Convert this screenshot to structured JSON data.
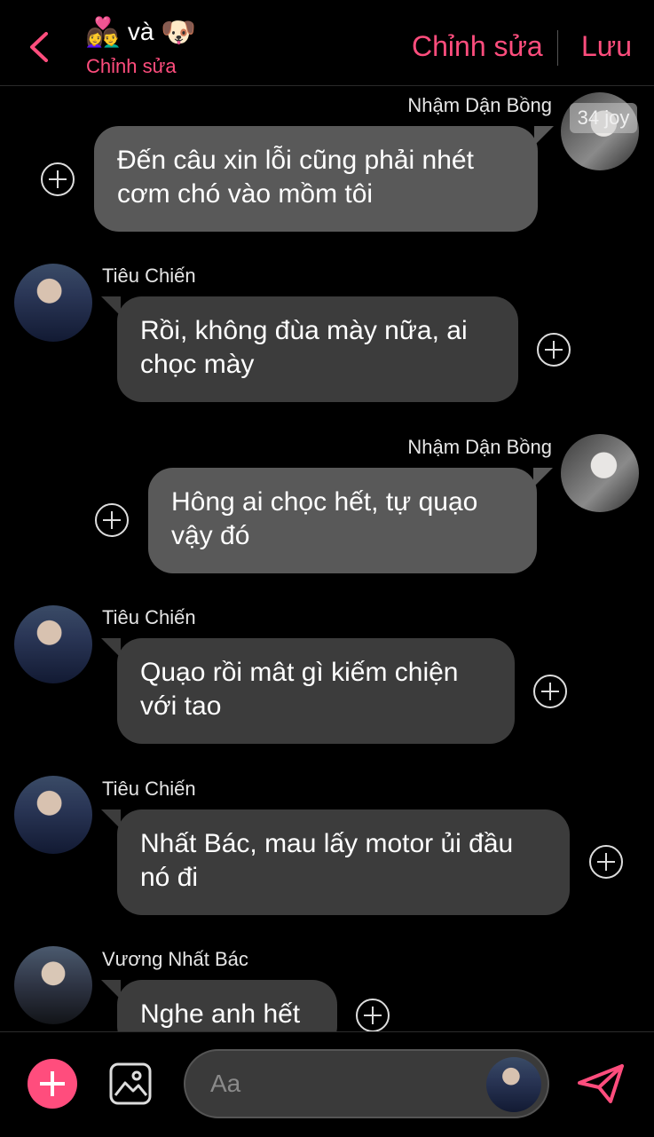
{
  "header": {
    "title_emoji_left": "👩‍❤️‍👨",
    "title_word": "và",
    "title_emoji_right": "🐶",
    "subtitle": "Chỉnh sửa",
    "edit_label": "Chỉnh sửa",
    "save_label": "Lưu"
  },
  "watermark": "34 joy",
  "messages": [
    {
      "sender": "Nhậm Dận Bồng",
      "text_line1": "Đến câu xin lỗi cũng phải nhét",
      "text_line2": "cơm chó vào mồm tôi"
    },
    {
      "sender": "Tiêu Chiến",
      "text_line1": "Rồi, không đùa mày nữa, ai",
      "text_line2": "chọc mày"
    },
    {
      "sender": "Nhậm Dận Bồng",
      "text_line1": "Hông ai chọc hết, tự quạo",
      "text_line2": "vậy đó"
    },
    {
      "sender": "Tiêu Chiến",
      "text_line1": "Quạo rồi mât gì kiếm chiện",
      "text_line2": "với tao"
    },
    {
      "sender": "Tiêu Chiến",
      "text_line1": "Nhất Bác, mau lấy motor ủi đầu",
      "text_line2": "nó đi"
    },
    {
      "sender": "Vương Nhất Bác",
      "text_line1": "Nghe anh hết",
      "text_line2": ""
    }
  ],
  "composer": {
    "placeholder": "Aa"
  },
  "colors": {
    "accent": "#ff4d7d",
    "bubble_other": "#3c3c3c",
    "bubble_me": "#595959",
    "background": "#000000"
  }
}
